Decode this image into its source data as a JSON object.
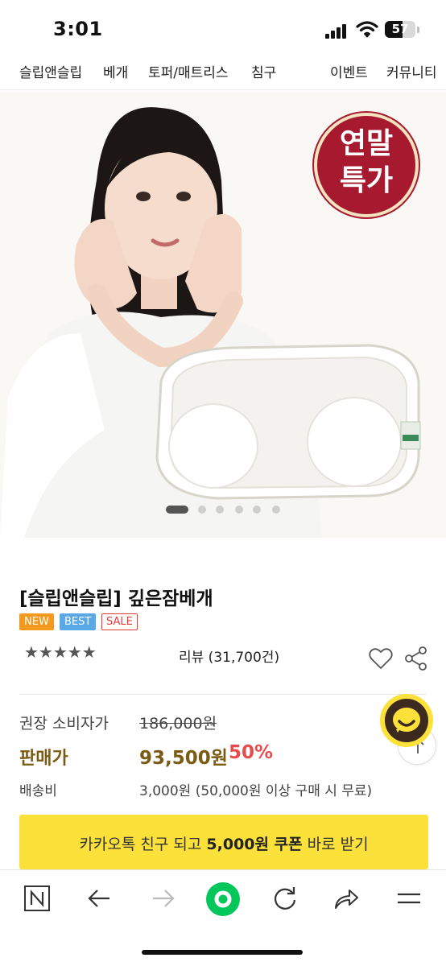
{
  "status": {
    "time": "3:01",
    "battery": "57",
    "battery_level": 0.57
  },
  "nav": {
    "items": [
      "슬립앤슬립",
      "베개",
      "토퍼/매트리스",
      "침구",
      "이벤트",
      "커뮤니티"
    ]
  },
  "hero": {
    "badge_line1": "연말",
    "badge_line2": "특가",
    "slide_count": 6,
    "active_slide": 1
  },
  "product": {
    "title": "[슬립앤슬립] 깊은잠베개",
    "tags": [
      "NEW",
      "BEST",
      "SALE"
    ],
    "rating_stars": "★★★★★",
    "rating": 5,
    "review": "리뷰 (31,700건)"
  },
  "price": {
    "msrp_label": "권장 소비자가",
    "msrp_value": "186,000원",
    "sale_label": "판매가",
    "sale_value": "93,500원",
    "sale_rate": "50%",
    "shipping_label": "배송비",
    "shipping_value": "3,000원 (50,000원 이상 구매 시 무료)"
  },
  "kakao_banner": {
    "text_pre": "카카오톡 친구 되고 ",
    "text_bold": "5,000원 쿠폰",
    "text_post": " 바로 받기"
  },
  "icons": {
    "heart": "heart-icon",
    "share": "share-icon",
    "kakao": "kakao-chat-icon",
    "top": "arrow-up-icon",
    "naver": "naver-n-icon",
    "back": "arrow-left-icon",
    "forward": "arrow-right-icon",
    "home": "green-home-icon",
    "refresh": "refresh-icon",
    "browser_share": "share-arrow-icon",
    "menu": "menu-icon"
  },
  "colors": {
    "accent_gold": "#7a5b14",
    "sale_red": "#e74c4c",
    "kakao_yellow": "#fbe13a",
    "badge_red": "#a6192e",
    "naver_green": "#03c75a"
  }
}
